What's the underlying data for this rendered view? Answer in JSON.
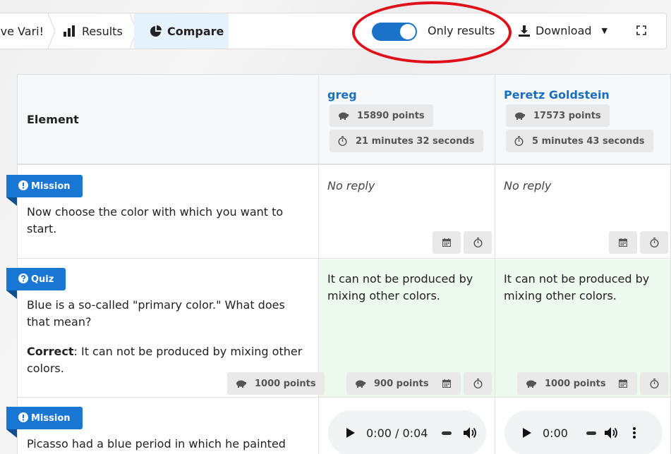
{
  "breadcrumb": {
    "crumb0": "ve Vari!",
    "results": "Results",
    "compare": "Compare"
  },
  "toolbar": {
    "only_results_label": "Only results",
    "only_results_on": true,
    "download_label": "Download"
  },
  "colors": {
    "accent": "#1976d2",
    "player_name": "#1a6fc2",
    "highlight": "#e0101a",
    "correct_bg": "#edf9ee"
  },
  "table": {
    "element_header": "Element",
    "players": [
      {
        "name": "greg",
        "points": "15890 points",
        "time": "21 minutes 32 seconds"
      },
      {
        "name": "Peretz Goldstein",
        "points": "17573 points",
        "time": "5 minutes 43 seconds"
      }
    ],
    "rows": [
      {
        "type": "Mission",
        "icon": "exclamation-icon",
        "text": "Now choose the color with which you want to start.",
        "answers": [
          "No reply",
          "No reply"
        ]
      },
      {
        "type": "Quiz",
        "icon": "question-icon",
        "text": "Blue is a so-called \"primary color.\" What does that mean?",
        "correct_label": "Correct",
        "correct_answer": ": It can not be produced by mixing other colors.",
        "points": "1000 points",
        "answers": [
          "It can not be produced by mixing other colors.",
          "It can not be produced by mixing other colors."
        ],
        "answer_points": [
          "900 points",
          "1000 points"
        ]
      },
      {
        "type": "Mission",
        "icon": "exclamation-icon",
        "text": "Picasso had a blue period in which he painted mainly",
        "audio": [
          "0:00 / 0:04",
          "0:00"
        ]
      }
    ]
  }
}
